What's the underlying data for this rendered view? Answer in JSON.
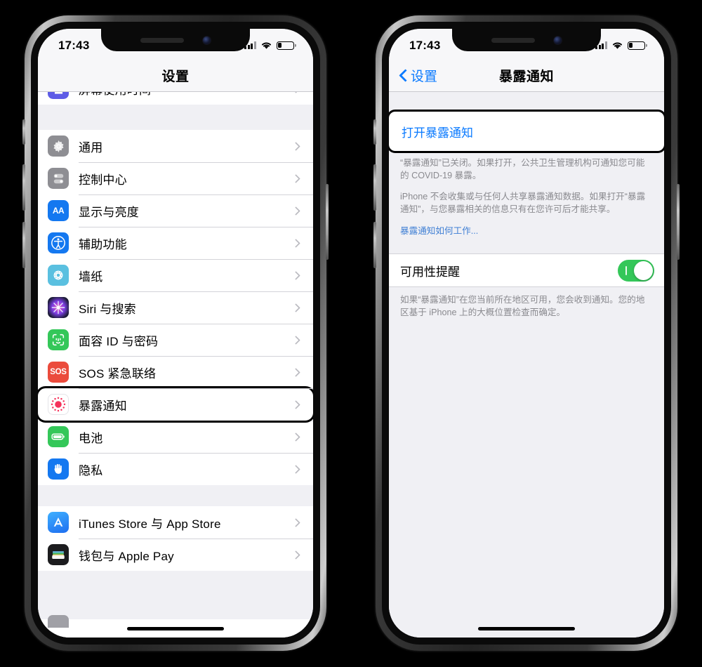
{
  "left_phone": {
    "status": {
      "time": "17:43",
      "signal_icon": "signal-bars-icon",
      "wifi_icon": "wifi-icon",
      "battery_icon": "battery-low-icon",
      "battery_level": 22
    },
    "navbar": {
      "title": "设置"
    },
    "clipped_top_row": {
      "label": "屏幕使用时间",
      "icon": "screen-time-icon"
    },
    "group_main": [
      {
        "label": "通用",
        "icon": "gear-icon",
        "color": "#8e8e93"
      },
      {
        "label": "控制中心",
        "icon": "control-center-icon",
        "color": "#8e8e93"
      },
      {
        "label": "显示与亮度",
        "icon": "display-aa-icon",
        "color": "#1478f0"
      },
      {
        "label": "辅助功能",
        "icon": "accessibility-icon",
        "color": "#1478f0"
      },
      {
        "label": "墙纸",
        "icon": "wallpaper-icon",
        "color": "#5ac0e0"
      },
      {
        "label": "Siri 与搜索",
        "icon": "siri-icon",
        "color": "#1b1c35"
      },
      {
        "label": "面容 ID 与密码",
        "icon": "face-id-icon",
        "color": "#34c759"
      },
      {
        "label": "SOS 紧急联络",
        "icon": "sos-icon",
        "color": "#eb4b3c"
      },
      {
        "label": "暴露通知",
        "icon": "exposure-notification-icon",
        "color": "#ffffff",
        "highlighted": true
      },
      {
        "label": "电池",
        "icon": "battery-icon",
        "color": "#34c759"
      },
      {
        "label": "隐私",
        "icon": "privacy-hand-icon",
        "color": "#1478f0"
      }
    ],
    "group_store": [
      {
        "label": "iTunes Store 与 App Store",
        "icon": "app-store-icon",
        "color": "#1e8af0"
      },
      {
        "label": "钱包与 Apple Pay",
        "icon": "wallet-icon",
        "color": "#1c1c1e"
      }
    ]
  },
  "right_phone": {
    "status": {
      "time": "17:43",
      "signal_icon": "signal-bars-icon",
      "wifi_icon": "wifi-icon",
      "battery_icon": "battery-low-icon",
      "battery_level": 22
    },
    "navbar": {
      "back_label": "设置",
      "title": "暴露通知",
      "back_icon": "chevron-left-icon"
    },
    "action_button": {
      "label": "打开暴露通知"
    },
    "footnote_paragraphs": [
      "“暴露通知”已关闭。如果打开，公共卫生管理机构可通知您可能的 COVID-19 暴露。",
      "iPhone 不会收集或与任何人共享暴露通知数据。如果打开“暴露通知”，与您暴露相关的信息只有在您许可后才能共享。"
    ],
    "footnote_link": "暴露通知如何工作...",
    "availability": {
      "label": "可用性提醒",
      "switch_state": "on",
      "switch_color": "#34c759",
      "description": "如果“暴露通知”在您当前所在地区可用，您会收到通知。您的地区基于 iPhone 上的大概位置检查而确定。"
    }
  },
  "theme": {
    "accent_blue": "#0a7aff",
    "link_blue": "#3f7fd4",
    "group_bg": "#f0f0f4",
    "row_bg": "#ffffff",
    "separator": "#d3d3d8",
    "footnote_text": "#8a8a8f",
    "highlight_outline": "#000000"
  }
}
